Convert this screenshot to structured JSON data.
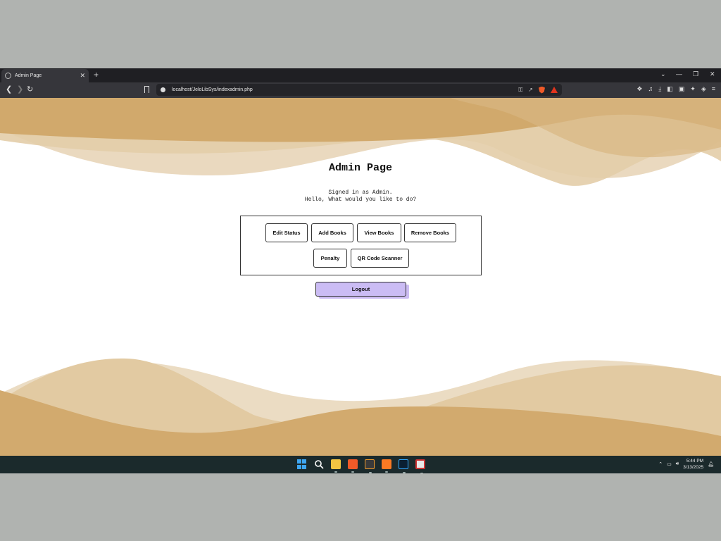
{
  "browser": {
    "tab_title": "Admin Page",
    "tab_close": "✕",
    "new_tab": "+",
    "url": "localhost/JeloLibSys/indexadmin.php",
    "window_controls": [
      "⌄",
      "—",
      "❐",
      "✕"
    ]
  },
  "page": {
    "title": "Admin Page",
    "signed_in_line": "Signed in as Admin.",
    "greeting_line": "Hello, What would you like to do?",
    "buttons": {
      "edit_status": "Edit Status",
      "add_books": "Add Books",
      "view_books": "View Books",
      "remove_books": "Remove Books",
      "penalty": "Penalty",
      "qr_scanner": "QR Code Scanner"
    },
    "logout_label": "Logout"
  },
  "taskbar": {
    "time": "5:44 PM",
    "date": "3/13/2025"
  },
  "colors": {
    "wave_dark": "#d0a86a",
    "wave_light": "#e6d2b2",
    "logout_bg": "#cbbcf4",
    "taskbar_bg": "#1b2a2c"
  }
}
